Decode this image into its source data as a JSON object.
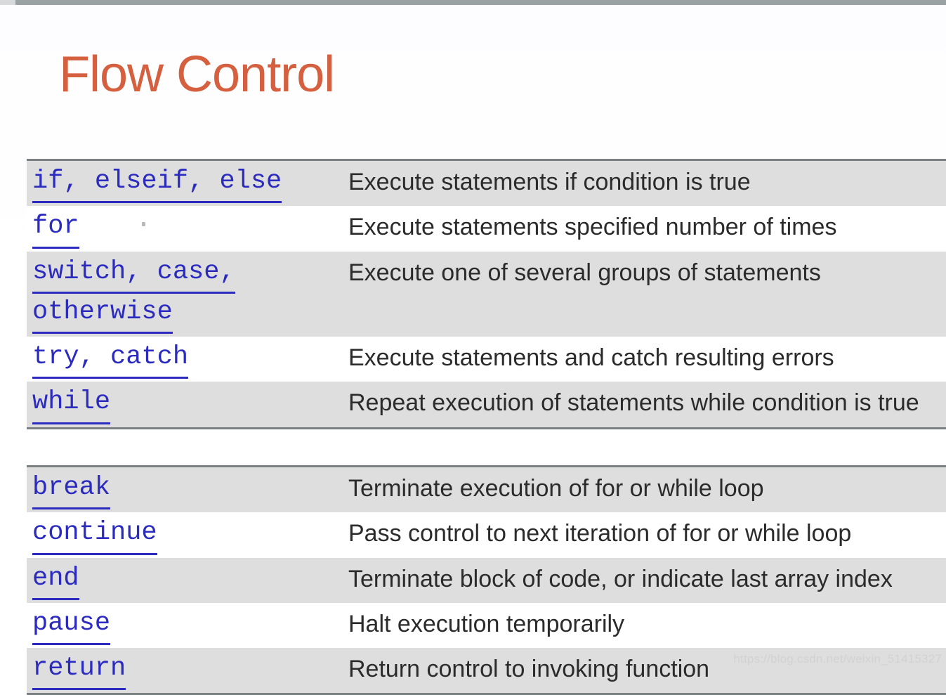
{
  "slide": {
    "title": "Flow Control",
    "title_color": "#d4603f",
    "background_color": "#ffffff",
    "link_color": "#2b2bc0",
    "shaded_row_color": "#dedede",
    "table_border_color": "#7b8183",
    "description_color": "#2b2b2b"
  },
  "tables": [
    {
      "id": "table-flow",
      "name": "flow-control-statements-table",
      "rows": [
        {
          "keyword_lines": [
            "if, elseif, else"
          ],
          "description": "Execute statements if condition is true",
          "shaded": true
        },
        {
          "keyword_lines": [
            "for"
          ],
          "description": "Execute statements specified number of times",
          "shaded": false
        },
        {
          "keyword_lines": [
            "switch, case,",
            "otherwise"
          ],
          "description": "Execute one of several groups of statements",
          "shaded": true
        },
        {
          "keyword_lines": [
            "try, catch"
          ],
          "description": "Execute statements and catch resulting errors",
          "shaded": false
        },
        {
          "keyword_lines": [
            "while"
          ],
          "description": "Repeat execution of statements while condition is true",
          "shaded": true
        }
      ]
    },
    {
      "id": "table-loop",
      "name": "loop-control-statements-table",
      "rows": [
        {
          "keyword_lines": [
            "break"
          ],
          "description": "Terminate execution of for or while loop",
          "shaded": true
        },
        {
          "keyword_lines": [
            "continue"
          ],
          "description": "Pass control to next iteration of for or while loop",
          "shaded": false
        },
        {
          "keyword_lines": [
            "end"
          ],
          "description": "Terminate block of code, or indicate last array index",
          "shaded": true
        },
        {
          "keyword_lines": [
            "pause"
          ],
          "description": "Halt execution temporarily",
          "shaded": false
        },
        {
          "keyword_lines": [
            "return"
          ],
          "description": "Return control to invoking function",
          "shaded": true
        }
      ]
    }
  ],
  "watermark": {
    "text": "https://blog.csdn.net/weixin_51415327"
  }
}
